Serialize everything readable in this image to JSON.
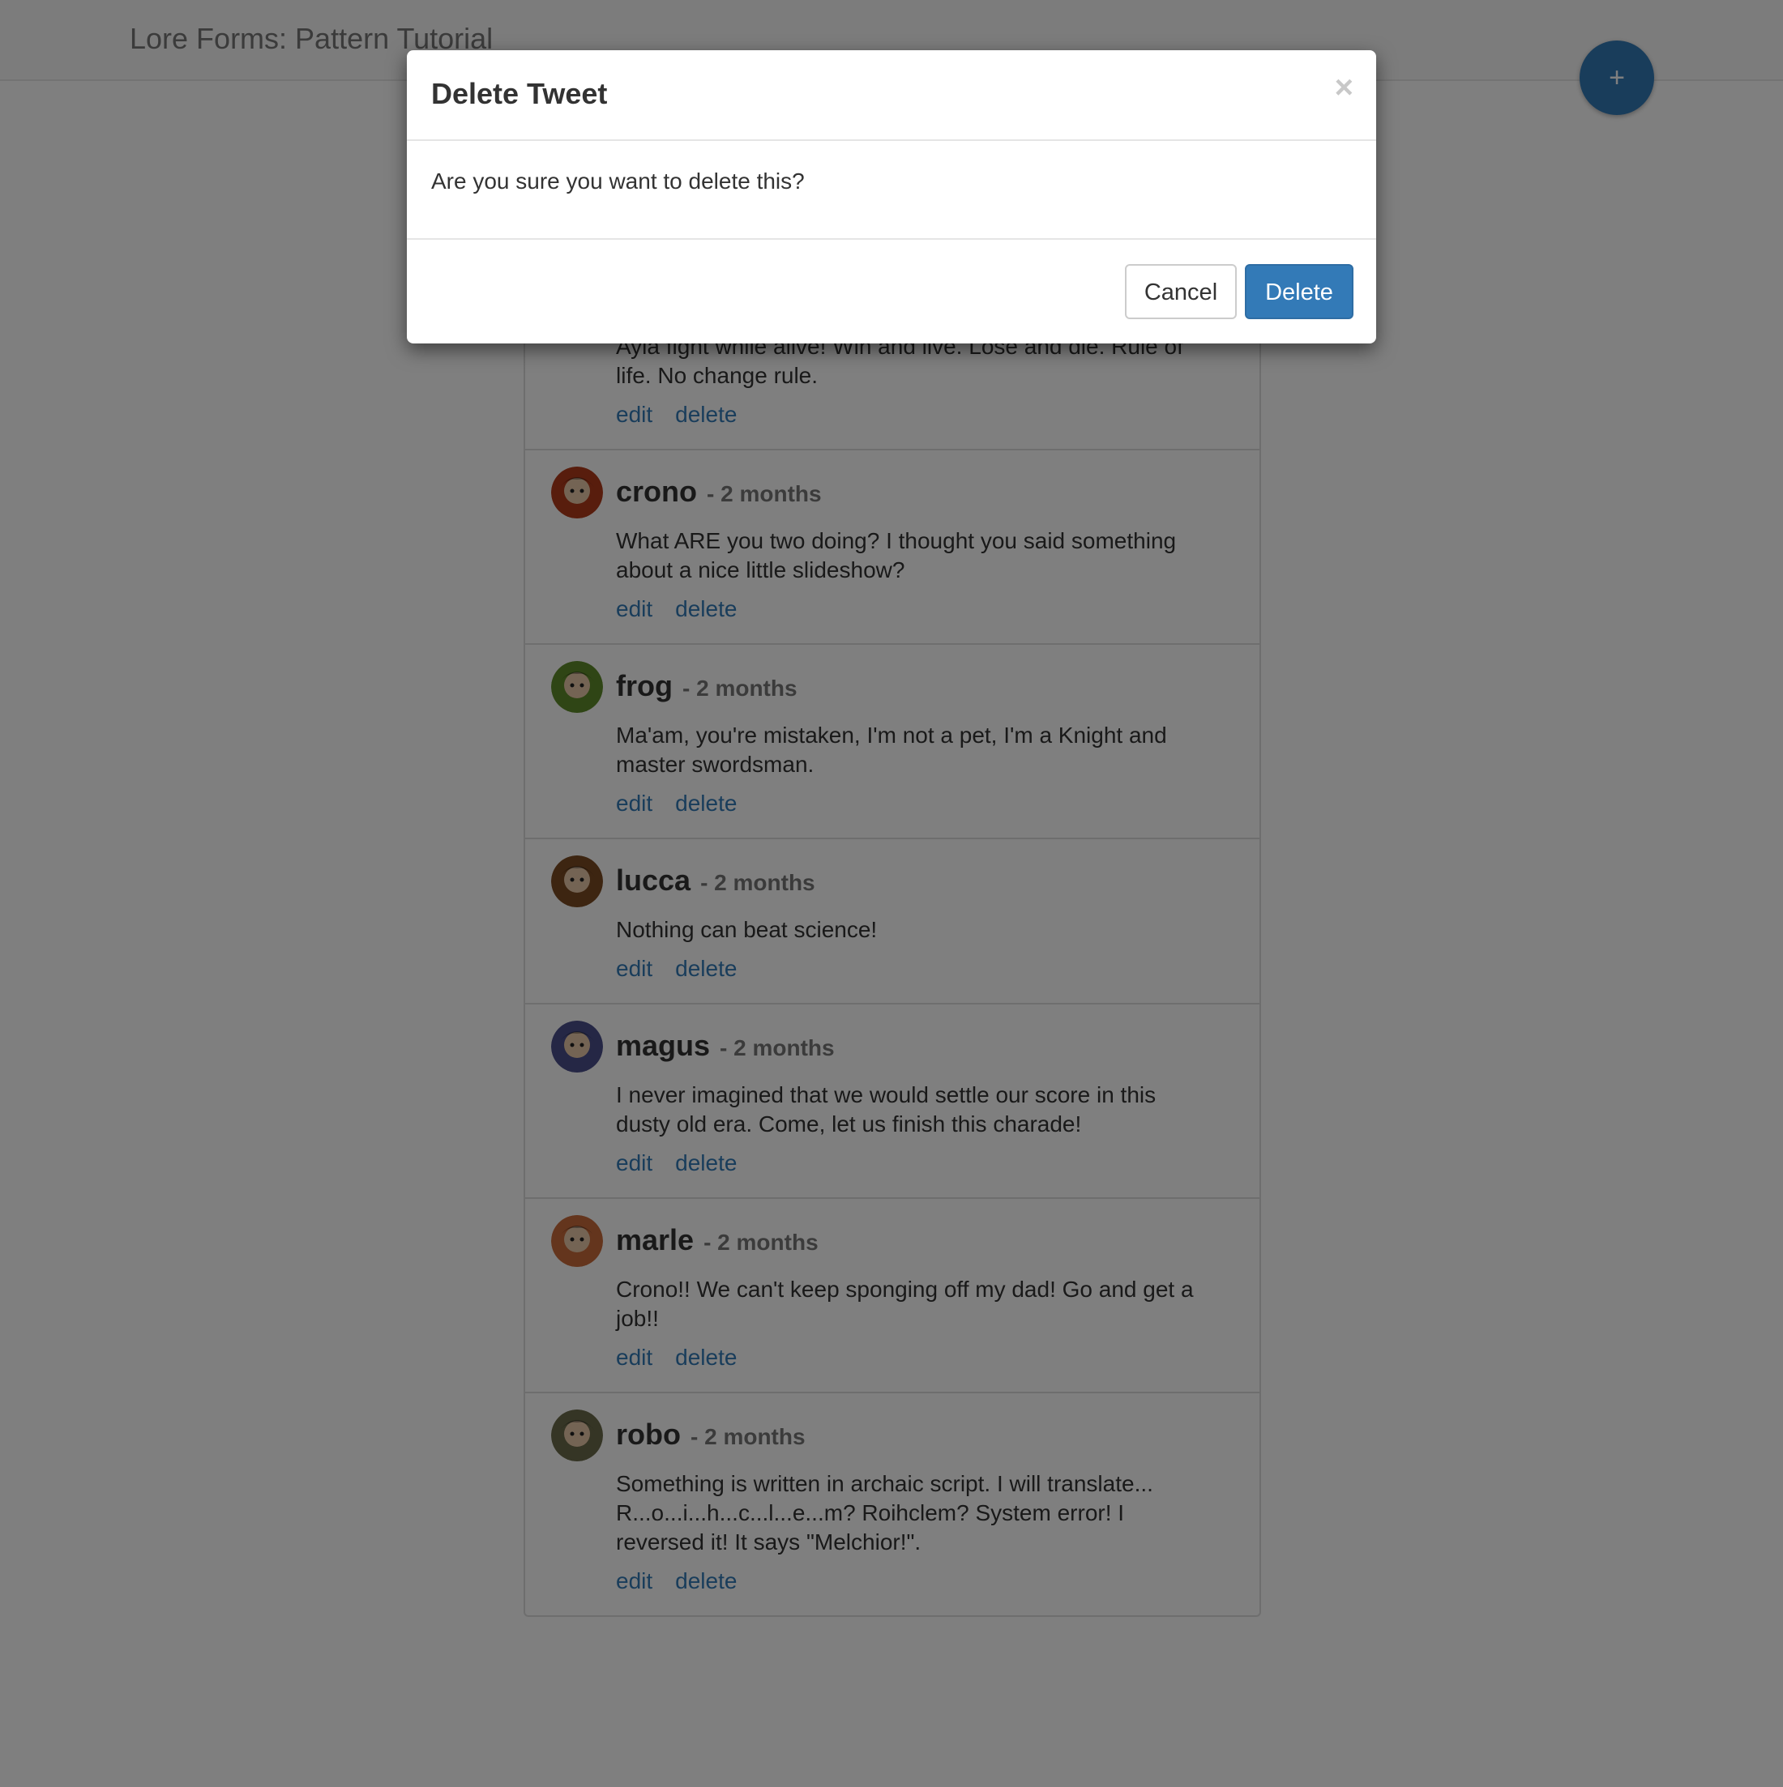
{
  "navbar": {
    "title": "Lore Forms: Pattern Tutorial",
    "add_button_label": "+"
  },
  "tweets": [
    {
      "user": "",
      "time": "",
      "text": "Ayla fight while alive! Win and live. Lose and die. Rule of life. No change rule.",
      "edit_label": "edit",
      "delete_label": "delete",
      "avatar_color": "#a0522d"
    },
    {
      "user": "crono",
      "time": "- 2 months",
      "text": "What ARE you two doing? I thought you said something about a nice little slideshow?",
      "edit_label": "edit",
      "delete_label": "delete",
      "avatar_color": "#b03a1a"
    },
    {
      "user": "frog",
      "time": "- 2 months",
      "text": "Ma'am, you're mistaken, I'm not a pet, I'm a Knight and master swordsman.",
      "edit_label": "edit",
      "delete_label": "delete",
      "avatar_color": "#5f8a2a"
    },
    {
      "user": "lucca",
      "time": "- 2 months",
      "text": "Nothing can beat science!",
      "edit_label": "edit",
      "delete_label": "delete",
      "avatar_color": "#7a4a22"
    },
    {
      "user": "magus",
      "time": "- 2 months",
      "text": "I never imagined that we would settle our score in this dusty old era. Come, let us finish this charade!",
      "edit_label": "edit",
      "delete_label": "delete",
      "avatar_color": "#4a4e8a"
    },
    {
      "user": "marle",
      "time": "- 2 months",
      "text": "Crono!! We can't keep sponging off my dad! Go and get a job!!",
      "edit_label": "edit",
      "delete_label": "delete",
      "avatar_color": "#c86a3a"
    },
    {
      "user": "robo",
      "time": "- 2 months",
      "text": "Something is written in archaic script. I will translate... R...o...i...h...c...l...e...m? Roihclem? System error! I reversed it! It says \"Melchior!\".",
      "edit_label": "edit",
      "delete_label": "delete",
      "avatar_color": "#6a6a4a"
    }
  ],
  "modal": {
    "title": "Delete Tweet",
    "close_label": "×",
    "message": "Are you sure you want to delete this?",
    "cancel_label": "Cancel",
    "delete_label": "Delete"
  },
  "colors": {
    "primary": "#337ab7",
    "backdrop": "rgba(0,0,0,0.5)"
  }
}
